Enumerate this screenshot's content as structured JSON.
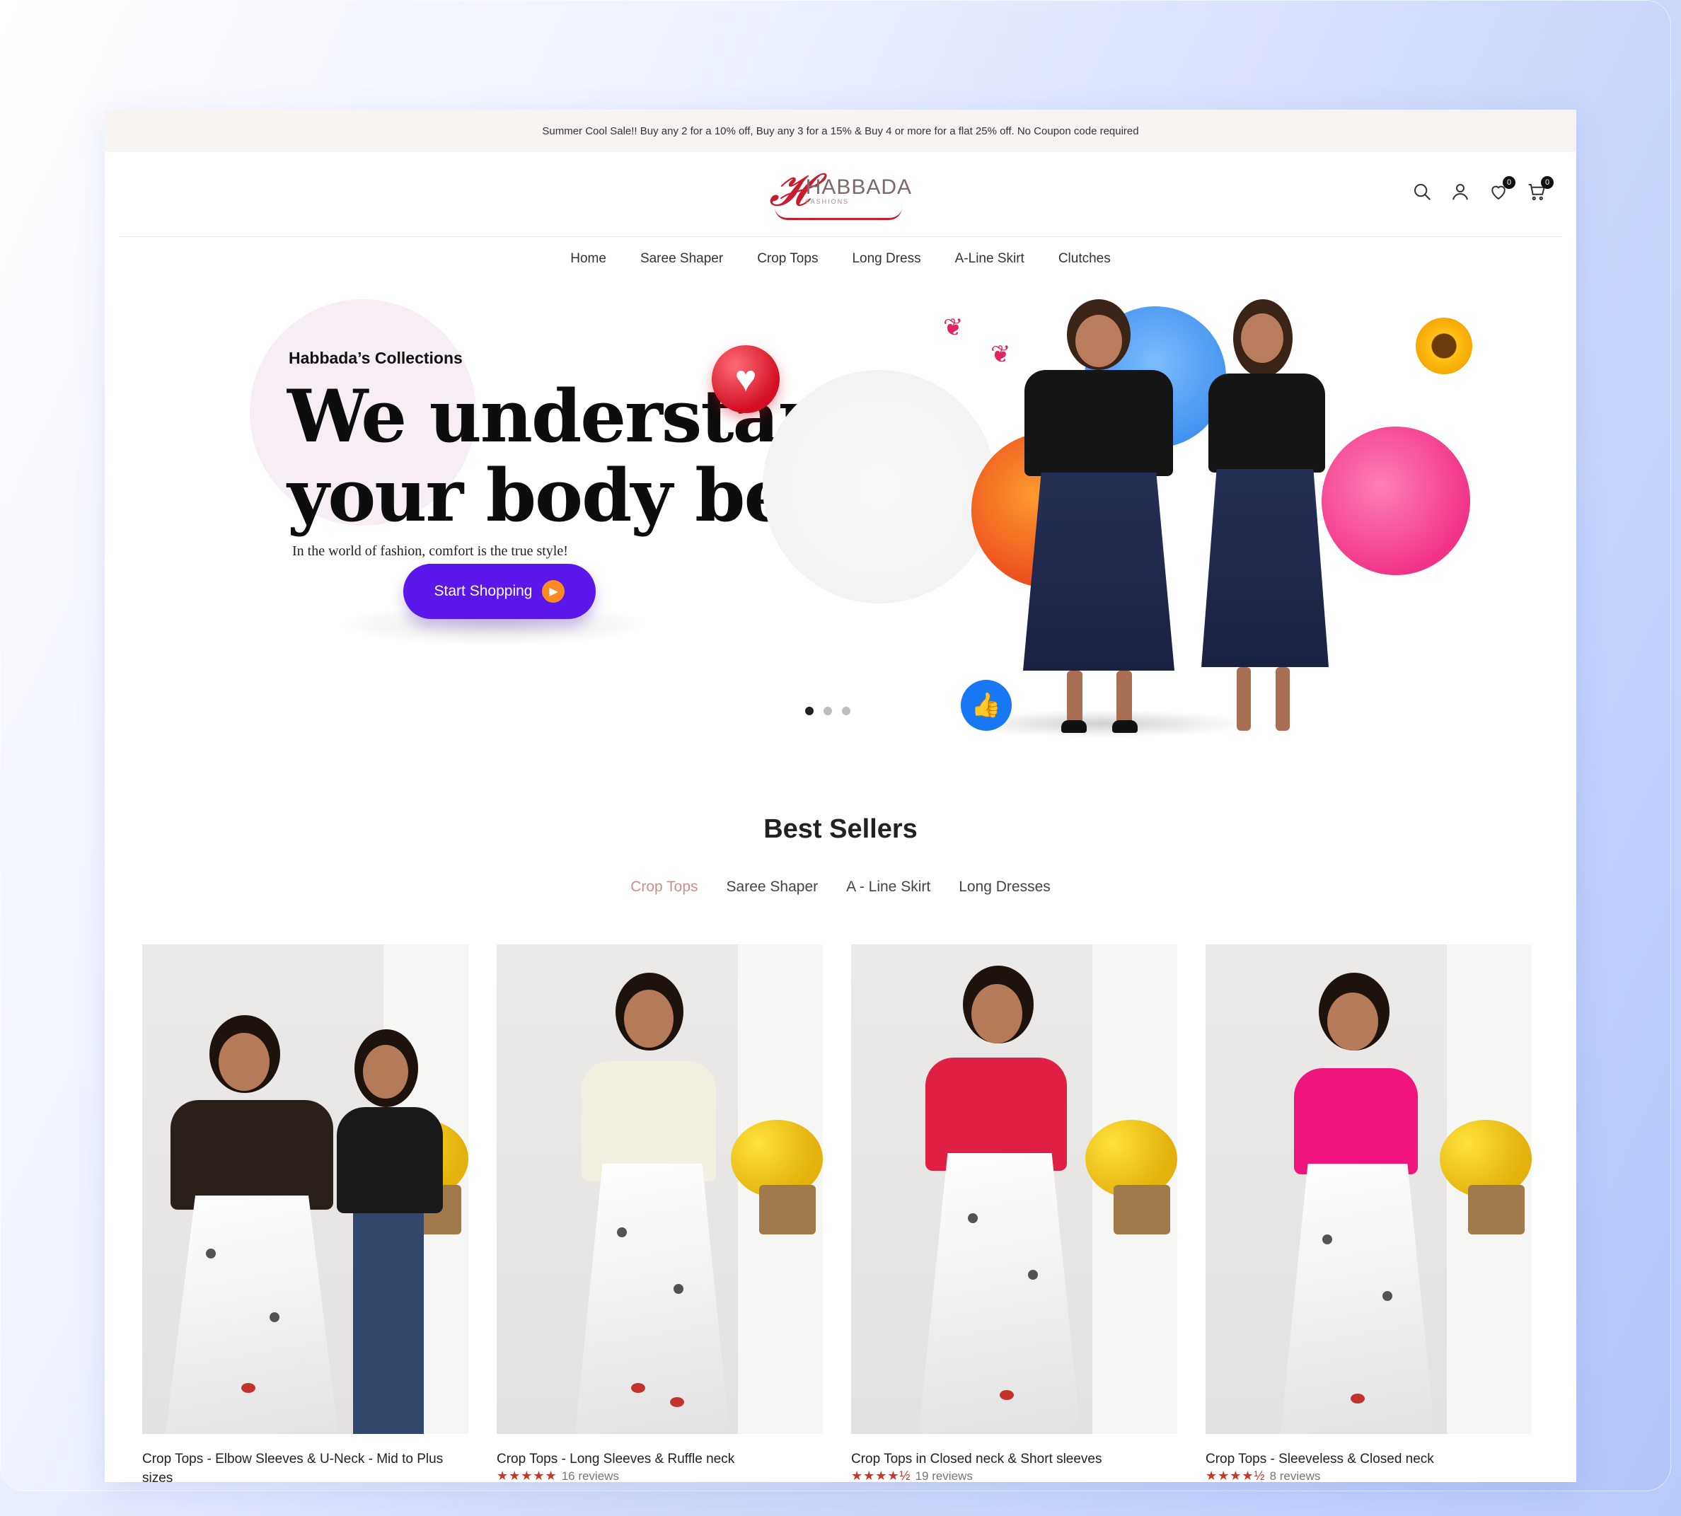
{
  "announcement": "Summer Cool Sale!! Buy any 2 for a 10% off, Buy any 3 for a 15% & Buy 4 or more for a flat 25% off. No Coupon code required",
  "brand": {
    "name": "HABBADA",
    "tagline": "FASHIONS"
  },
  "header_icons": [
    {
      "name": "search-icon"
    },
    {
      "name": "account-icon"
    },
    {
      "name": "wishlist-icon",
      "count": "0"
    },
    {
      "name": "cart-icon",
      "count": "0"
    }
  ],
  "nav": [
    "Home",
    "Saree Shaper",
    "Crop Tops",
    "Long Dress",
    "A-Line Skirt",
    "Clutches"
  ],
  "hero": {
    "eyebrow": "Habbada’s Collections",
    "title_line1": "We understand",
    "title_line2": "your body better",
    "subtitle": "In the world of fashion, comfort is the true style!",
    "cta": "Start Shopping",
    "slides": 3,
    "active_slide": 0
  },
  "best_sellers": {
    "title": "Best Sellers",
    "tabs": [
      "Crop Tops",
      "Saree Shaper",
      "A - Line Skirt",
      "Long Dresses"
    ],
    "active_tab": "Crop Tops"
  },
  "products": [
    {
      "title": "Crop Tops - Elbow Sleeves & U-Neck - Mid to Plus sizes",
      "rating": 0,
      "reviews": "",
      "blouse_color": "#2a1f19"
    },
    {
      "title": "Crop Tops - Long Sleeves & Ruffle neck",
      "rating": 5,
      "reviews": "16 reviews",
      "blouse_color": "#f3efe0"
    },
    {
      "title": "Crop Tops in Closed neck & Short sleeves",
      "rating": 4.5,
      "reviews": "19 reviews",
      "blouse_color": "#e01f45"
    },
    {
      "title": "Crop Tops - Sleeveless & Closed neck",
      "rating": 4.5,
      "reviews": "8 reviews",
      "blouse_color": "#f0157d"
    }
  ],
  "colors": {
    "cta": "#5b17ea",
    "active_tab": "#c9908c",
    "stars": "#c0392b",
    "brand_red": "#c61e2e"
  }
}
